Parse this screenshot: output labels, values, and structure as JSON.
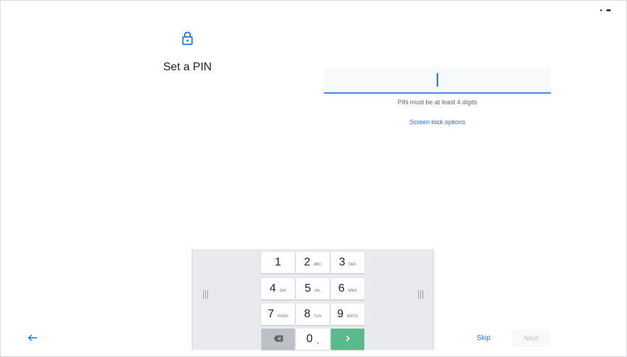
{
  "header": {
    "title": "Set a PIN",
    "icon": "lock-icon"
  },
  "pin": {
    "value": "",
    "hint": "PIN must be at least 4 digits",
    "options_link": "Screen lock options"
  },
  "keypad": {
    "keys": [
      {
        "digit": "1",
        "letters": ""
      },
      {
        "digit": "2",
        "letters": "ABC"
      },
      {
        "digit": "3",
        "letters": "DEF"
      },
      {
        "digit": "4",
        "letters": "GHI"
      },
      {
        "digit": "5",
        "letters": "JKL"
      },
      {
        "digit": "6",
        "letters": "MNO"
      },
      {
        "digit": "7",
        "letters": "PQRS"
      },
      {
        "digit": "8",
        "letters": "TUV"
      },
      {
        "digit": "9",
        "letters": "WXYZ"
      }
    ],
    "zero": "0",
    "zero_extra": ".",
    "backspace_icon": "backspace-icon",
    "enter_icon": "chevron-right-icon"
  },
  "footer": {
    "back_icon": "arrow-left-icon",
    "skip_label": "Skip",
    "next_label": "Next"
  },
  "colors": {
    "accent": "#1a73e8",
    "enter_key": "#5bb98b",
    "keyboard_bg": "#e8eaed"
  }
}
